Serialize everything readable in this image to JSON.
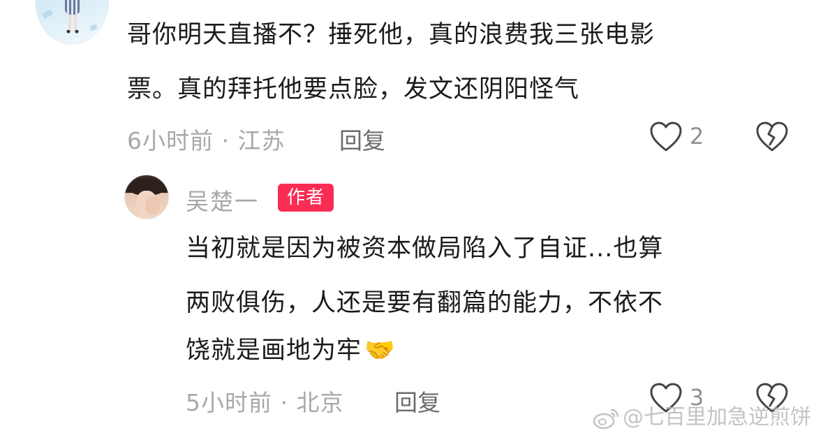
{
  "comments": [
    {
      "text_line1": "哥你明天直播不？捶死他，真的浪费我三张电影",
      "text_line2": "票。真的拜托他要点脸，发文还阴阳怪气",
      "meta": "6小时前 · 江苏",
      "reply_label": "回复",
      "like_count": "2"
    }
  ],
  "reply": {
    "author_name": "吴楚一",
    "author_badge": "作者",
    "text_line1": "当初就是因为被资本做局陷入了自证...也算",
    "text_line2": "两败俱伤，人还是要有翻篇的能力，不依不",
    "text_line3": "饶就是画地为牢",
    "text_emoji": "🤝",
    "meta": "5小时前 · 北京",
    "reply_label": "回复",
    "like_count": "3"
  },
  "watermark": {
    "text": "@七百里加急逆煎饼"
  },
  "colors": {
    "badge_bg": "#fb2c54",
    "text_primary": "#1b1b1b",
    "text_meta": "#a8a8a8"
  },
  "icons": [
    "heart-outline-icon",
    "broken-heart-icon",
    "weibo-logo-icon"
  ]
}
